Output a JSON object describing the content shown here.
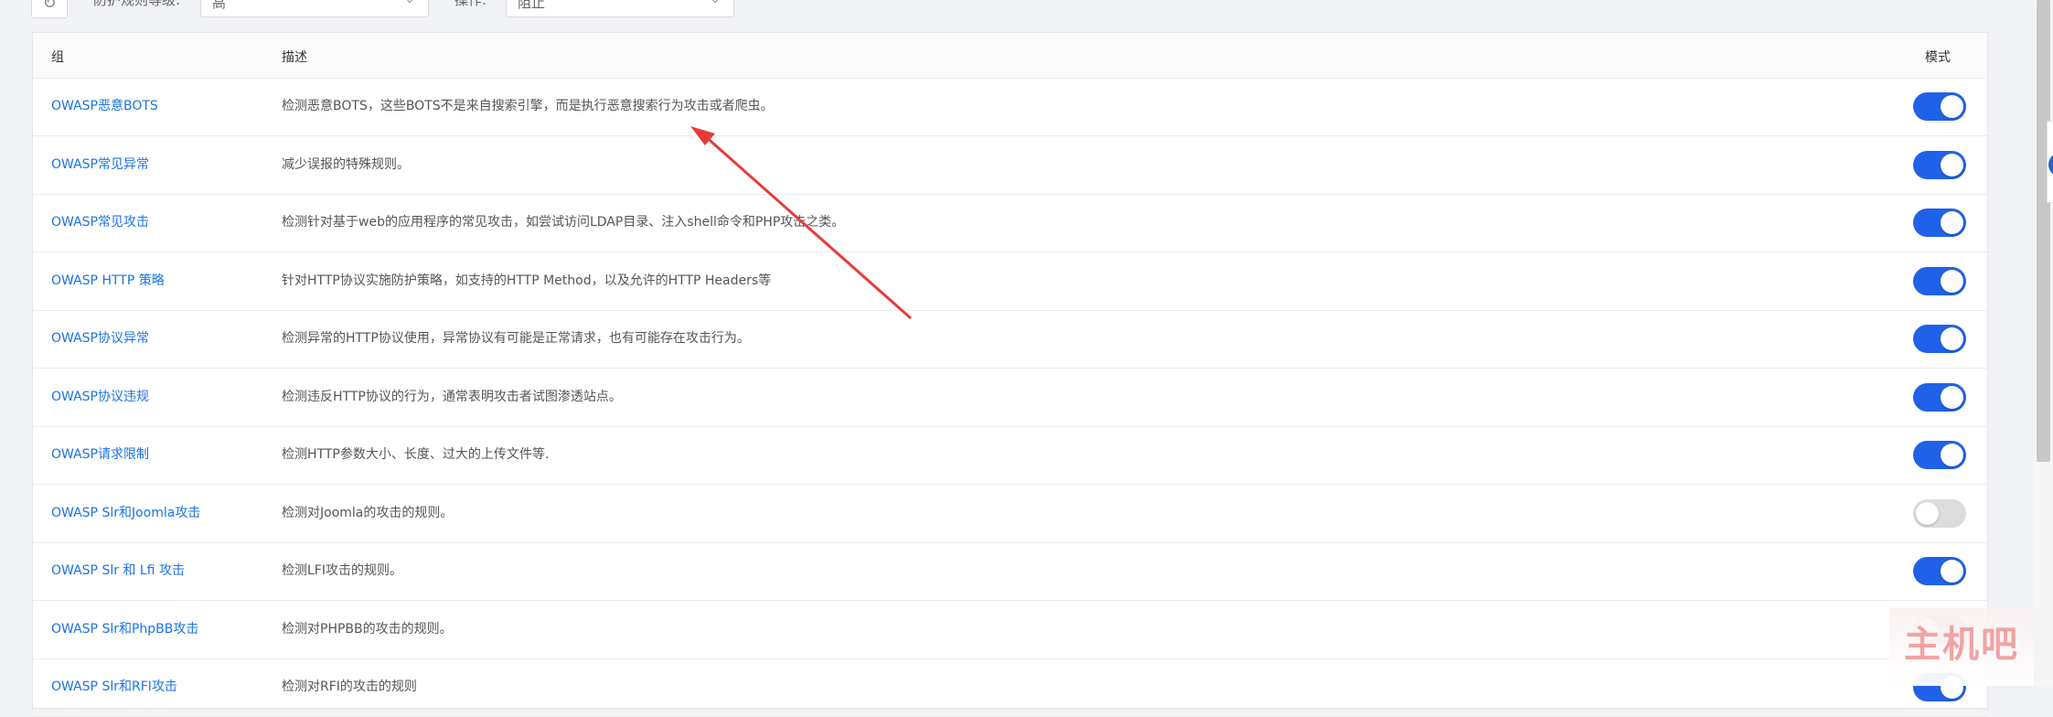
{
  "toolbar": {
    "refresh_icon": "refresh-icon",
    "level_label": "防护规则等级:",
    "level_value": "高",
    "action_label": "操作:",
    "action_value": "阻止"
  },
  "table": {
    "headers": {
      "group": "组",
      "desc": "描述",
      "mode": "模式"
    },
    "rows": [
      {
        "group": "OWASP恶意BOTS",
        "desc": "检测恶意BOTS，这些BOTS不是来自搜索引擎，而是执行恶意搜索行为攻击或者爬虫。",
        "enabled": true
      },
      {
        "group": "OWASP常见异常",
        "desc": "减少误报的特殊规则。",
        "enabled": true
      },
      {
        "group": "OWASP常见攻击",
        "desc": "检测针对基于web的应用程序的常见攻击，如尝试访问LDAP目录、注入shell命令和PHP攻击之类。",
        "enabled": true
      },
      {
        "group": "OWASP HTTP 策略",
        "desc": "针对HTTP协议实施防护策略，如支持的HTTP Method，以及允许的HTTP Headers等",
        "enabled": true
      },
      {
        "group": "OWASP协议异常",
        "desc": "检测异常的HTTP协议使用，异常协议有可能是正常请求，也有可能存在攻击行为。",
        "enabled": true
      },
      {
        "group": "OWASP协议违规",
        "desc": "检测违反HTTP协议的行为，通常表明攻击者试图渗透站点。",
        "enabled": true
      },
      {
        "group": "OWASP请求限制",
        "desc": "检测HTTP参数大小、长度、过大的上传文件等.",
        "enabled": true
      },
      {
        "group": "OWASP Slr和Joomla攻击",
        "desc": "检测对Joomla的攻击的规则。",
        "enabled": false
      },
      {
        "group": "OWASP Slr 和 Lfi 攻击",
        "desc": "检测LFI攻击的规则。",
        "enabled": true
      },
      {
        "group": "OWASP Slr和PhpBB攻击",
        "desc": "检测对PHPBB的攻击的规则。",
        "enabled": false
      },
      {
        "group": "OWASP Slr和RFI攻击",
        "desc": "检测对RFI的攻击的规则",
        "enabled": true
      }
    ]
  },
  "annotation": {
    "arrow_color": "#e83a3a"
  },
  "watermark": {
    "text": "主机吧"
  },
  "colors": {
    "accent": "#1f62e8",
    "link": "#1a73e8",
    "toggle_off": "#dcdcdc"
  }
}
